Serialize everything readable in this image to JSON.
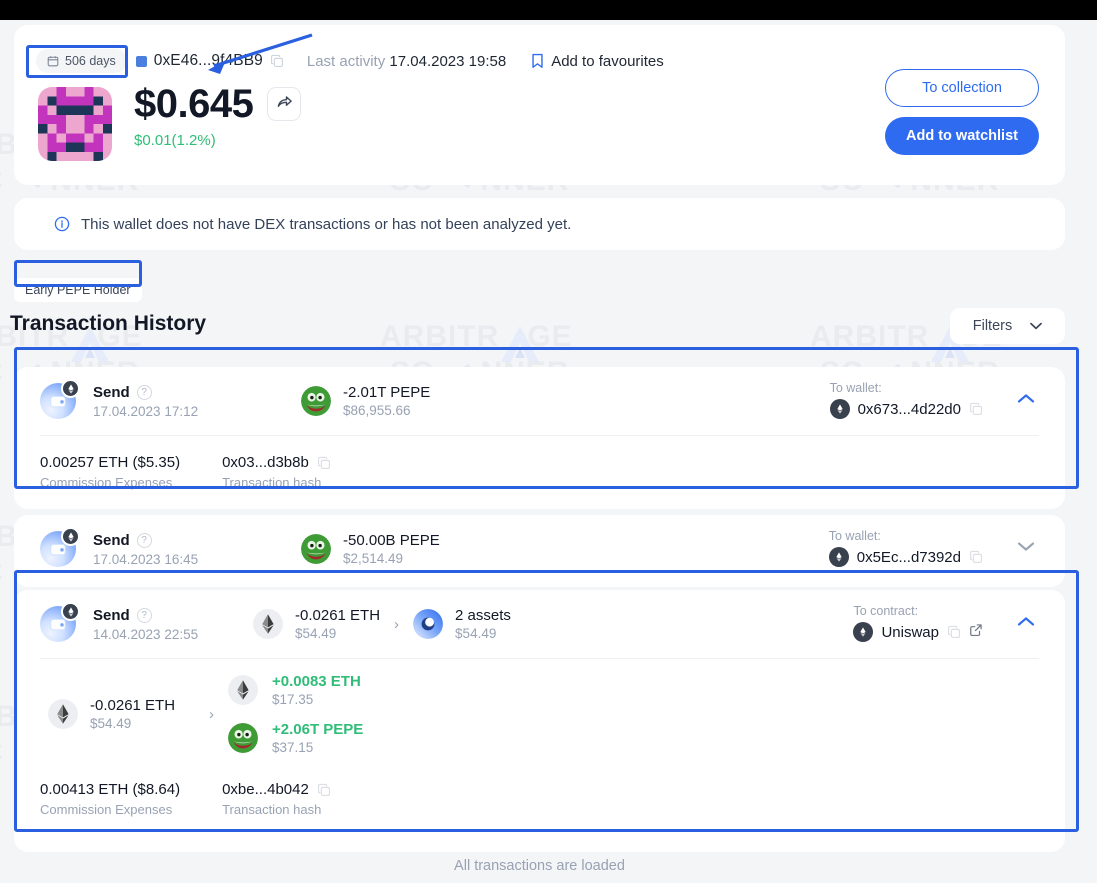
{
  "header": {
    "days_chip": "506 days",
    "wallet_address": "0xE46...9f4BB9",
    "last_activity_label": "Last activity",
    "last_activity_value": "17.04.2023 19:58",
    "favourites_label": "Add to favourites",
    "price": "$0.645",
    "delta": "$0.01(1.2%)",
    "to_collection_label": "To collection",
    "add_watchlist_label": "Add to watchlist",
    "icons": {
      "calendar": "calendar-icon",
      "copy": "copy-icon",
      "bookmark": "bookmark-icon",
      "share": "share-icon"
    }
  },
  "notice": {
    "text": "This wallet does not have DEX transactions or has not been analyzed yet.",
    "icon": "info-icon"
  },
  "tag": "Early PEPE Holder",
  "section_title": "Transaction History",
  "filters": {
    "label": "Filters",
    "icon": "chevron-down-icon"
  },
  "transactions": [
    {
      "type": "Send",
      "date": "17.04.2023 17:12",
      "asset_icon": "pepe-token-icon",
      "amount": "-2.01T PEPE",
      "usd": "$86,955.66",
      "to_label": "To wallet:",
      "to_value": "0x673...4d22d0",
      "expanded": true,
      "chevron": "chevron-up-icon",
      "commission_value": "0.00257 ETH ($5.35)",
      "commission_label": "Commission Expenses",
      "hash_value": "0x03...d3b8b",
      "hash_label": "Transaction hash",
      "highlighted": true
    },
    {
      "type": "Send",
      "date": "17.04.2023 16:45",
      "asset_icon": "pepe-token-icon",
      "amount": "-50.00B PEPE",
      "usd": "$2,514.49",
      "to_label": "To wallet:",
      "to_value": "0x5Ec...d7392d",
      "expanded": false,
      "chevron": "chevron-down-icon",
      "highlighted": false
    },
    {
      "type": "Send",
      "date": "14.04.2023 22:55",
      "asset_icon": "eth-token-icon",
      "amount": "-0.0261 ETH",
      "usd": "$54.49",
      "swap_to_icon": "multi-assets-icon",
      "swap_to_amount": "2 assets",
      "swap_to_usd": "$54.49",
      "to_label": "To contract:",
      "to_value": "Uniswap",
      "expanded": true,
      "chevron": "chevron-up-icon",
      "swap_in": {
        "icon": "eth-token-icon",
        "amount": "-0.0261 ETH",
        "usd": "$54.49"
      },
      "swap_out": [
        {
          "icon": "eth-token-icon",
          "amount": "+0.0083 ETH",
          "usd": "$17.35"
        },
        {
          "icon": "pepe-token-icon",
          "amount": "+2.06T PEPE",
          "usd": "$37.15"
        }
      ],
      "commission_value": "0.00413 ETH ($8.64)",
      "commission_label": "Commission Expenses",
      "hash_value": "0xbe...4b042",
      "hash_label": "Transaction hash",
      "highlighted": true,
      "external_link_icon": "external-link-icon"
    }
  ],
  "footer_note": "All transactions are loaded",
  "watermark": {
    "line1": "ARBITRAGE",
    "line2": "SCANNER"
  },
  "colors": {
    "accent": "#2f6bf0",
    "positive": "#2fbd77",
    "muted": "#98a2b3",
    "text": "#121826",
    "page_bg": "#f4f5f7",
    "highlight": "#2a5fe0"
  }
}
